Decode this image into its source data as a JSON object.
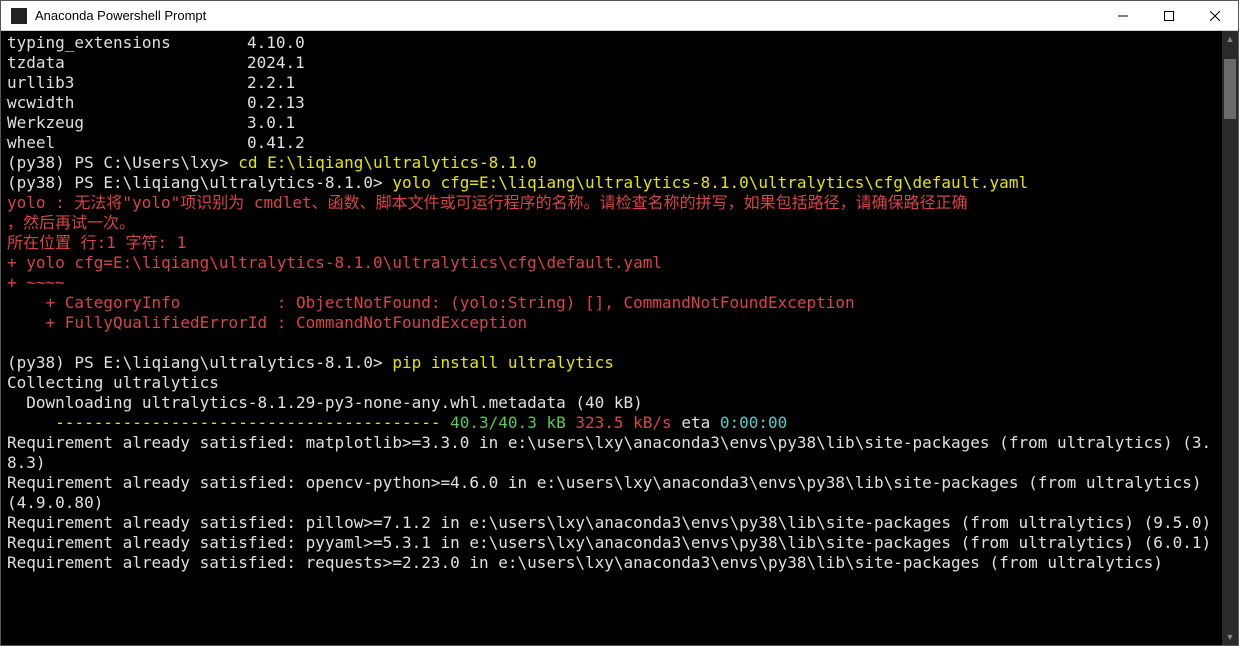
{
  "titlebar": {
    "title": "Anaconda Powershell Prompt"
  },
  "packages": [
    {
      "name": "typing_extensions",
      "version": "4.10.0"
    },
    {
      "name": "tzdata",
      "version": "2024.1"
    },
    {
      "name": "urllib3",
      "version": "2.2.1"
    },
    {
      "name": "wcwidth",
      "version": "0.2.13"
    },
    {
      "name": "Werkzeug",
      "version": "3.0.1"
    },
    {
      "name": "wheel",
      "version": "0.41.2"
    }
  ],
  "prompt1": {
    "env": "(py38) PS ",
    "path": "C:\\Users\\lxy> ",
    "cmd": "cd E:\\liqiang\\ultralytics-8.1.0"
  },
  "prompt2": {
    "env": "(py38) PS ",
    "path": "E:\\liqiang\\ultralytics-8.1.0> ",
    "cmd": "yolo cfg=E:\\liqiang\\ultralytics-8.1.0\\ultralytics\\cfg\\default.yaml"
  },
  "error": {
    "line1": "yolo : 无法将\"yolo\"项识别为 cmdlet、函数、脚本文件或可运行程序的名称。请检查名称的拼写，如果包括路径，请确保路径正确",
    "line2": "，然后再试一次。",
    "line3": "所在位置 行:1 字符: 1",
    "line4": "+ yolo cfg=E:\\liqiang\\ultralytics-8.1.0\\ultralytics\\cfg\\default.yaml",
    "line5": "+ ~~~~",
    "line6": "    + CategoryInfo          : ObjectNotFound: (yolo:String) [], CommandNotFoundException",
    "line7": "    + FullyQualifiedErrorId : CommandNotFoundException"
  },
  "prompt3": {
    "env": "(py38) PS ",
    "path": "E:\\liqiang\\ultralytics-8.1.0> ",
    "cmd": "pip install ultralytics"
  },
  "pip": {
    "collecting": "Collecting ultralytics",
    "downloading": "  Downloading ultralytics-8.1.29-py3-none-any.whl.metadata (40 kB)",
    "bar_prefix": "     ",
    "bar_dashes": "---------------------------------------- ",
    "bar_done": "40.3/40.3 kB",
    "bar_speed": " 323.5 kB/s",
    "bar_eta_label": " eta ",
    "bar_eta": "0:00:00",
    "req1": "Requirement already satisfied: matplotlib>=3.3.0 in e:\\users\\lxy\\anaconda3\\envs\\py38\\lib\\site-packages (from ultralytics) (3.8.3)",
    "req2": "Requirement already satisfied: opencv-python>=4.6.0 in e:\\users\\lxy\\anaconda3\\envs\\py38\\lib\\site-packages (from ultralytics) (4.9.0.80)",
    "req3": "Requirement already satisfied: pillow>=7.1.2 in e:\\users\\lxy\\anaconda3\\envs\\py38\\lib\\site-packages (from ultralytics) (9.5.0)",
    "req4": "Requirement already satisfied: pyyaml>=5.3.1 in e:\\users\\lxy\\anaconda3\\envs\\py38\\lib\\site-packages (from ultralytics) (6.0.1)",
    "req5": "Requirement already satisfied: requests>=2.23.0 in e:\\users\\lxy\\anaconda3\\envs\\py38\\lib\\site-packages (from ultralytics)"
  }
}
